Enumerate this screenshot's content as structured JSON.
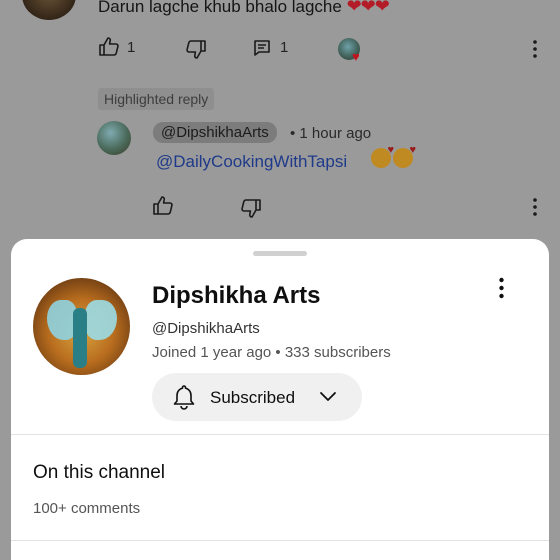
{
  "comment": {
    "text": "Darun lagche khub bhalo lagche",
    "hearts": "❤❤❤",
    "like_count": "1",
    "reply_count": "1"
  },
  "highlighted_reply": {
    "label": "Highlighted reply",
    "handle": "@DipshikhaArts",
    "time": "• 1 hour ago",
    "mention": "@DailyCookingWithTapsi"
  },
  "channel_sheet": {
    "name": "Dipshikha Arts",
    "handle": "@DipshikhaArts",
    "meta": "Joined 1 year ago • 333 subscribers",
    "subscribe_label": "Subscribed",
    "section_title": "On this channel",
    "comments_count": "100+ comments"
  },
  "icons": {
    "like": "thumbs-up-icon",
    "dislike": "thumbs-down-icon",
    "reply": "comment-icon",
    "more": "more-vertical-icon",
    "bell": "bell-icon",
    "chevron": "chevron-down-icon"
  },
  "colors": {
    "heart": "#b31b27",
    "mention": "#1f3a8a",
    "sheet_bg": "#ffffff",
    "overlay": "#9a9a9a"
  }
}
